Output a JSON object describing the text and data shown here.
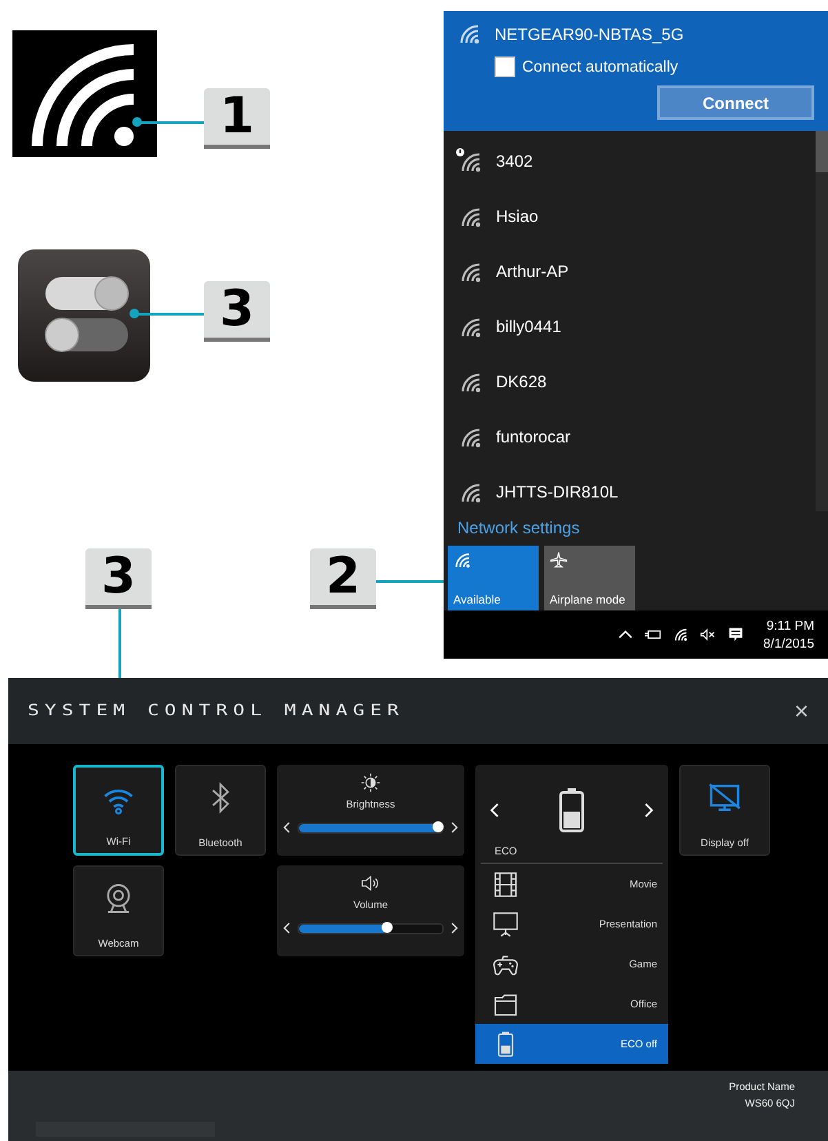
{
  "callouts": [
    {
      "number": "1"
    },
    {
      "number": "3"
    },
    {
      "number": "3"
    },
    {
      "number": "2"
    }
  ],
  "network_flyout": {
    "selected_network": {
      "name": "NETGEAR90-NBTAS_5G",
      "connect_automatically": {
        "label": "Connect automatically",
        "checked": false
      },
      "button": "Connect"
    },
    "networks": [
      {
        "name": "3402",
        "kind": "warning"
      },
      {
        "name": "Hsiao",
        "kind": "plain"
      },
      {
        "name": "Arthur-AP",
        "kind": "plain"
      },
      {
        "name": "billy0441",
        "kind": "plain"
      },
      {
        "name": "DK628",
        "kind": "plain"
      },
      {
        "name": "funtorocar",
        "kind": "plain"
      },
      {
        "name": "JHTTS-DIR810L",
        "kind": "plain"
      }
    ],
    "settings_link": "Network settings",
    "quick_tiles": [
      {
        "label": "Available",
        "selected": true
      },
      {
        "label": "Airplane mode",
        "selected": false
      }
    ],
    "taskbar": {
      "time": "9:11 PM",
      "date": "8/1/2015"
    }
  },
  "system_control_manager": {
    "title": "SYSTEM CONTROL MANAGER",
    "close": "×",
    "tiles": [
      {
        "label": "Wi-Fi",
        "selected": true,
        "on": true
      },
      {
        "label": "Bluetooth",
        "selected": false,
        "on": false
      },
      {
        "label": "Display off",
        "selected": false,
        "on": true
      },
      {
        "label": "Webcam",
        "selected": false,
        "on": false
      }
    ],
    "sliders": [
      {
        "label": "Brightness",
        "level": 0.97
      },
      {
        "label": "Volume",
        "level": 0.62
      }
    ],
    "power": {
      "current": "ECO",
      "modes": [
        {
          "label": "Movie",
          "selected": false
        },
        {
          "label": "Presentation",
          "selected": false
        },
        {
          "label": "Game",
          "selected": false
        },
        {
          "label": "Office",
          "selected": false
        },
        {
          "label": "ECO off",
          "selected": true
        }
      ]
    },
    "footer": {
      "product_label": "Product Name",
      "product_name": "WS60 6QJ"
    }
  }
}
